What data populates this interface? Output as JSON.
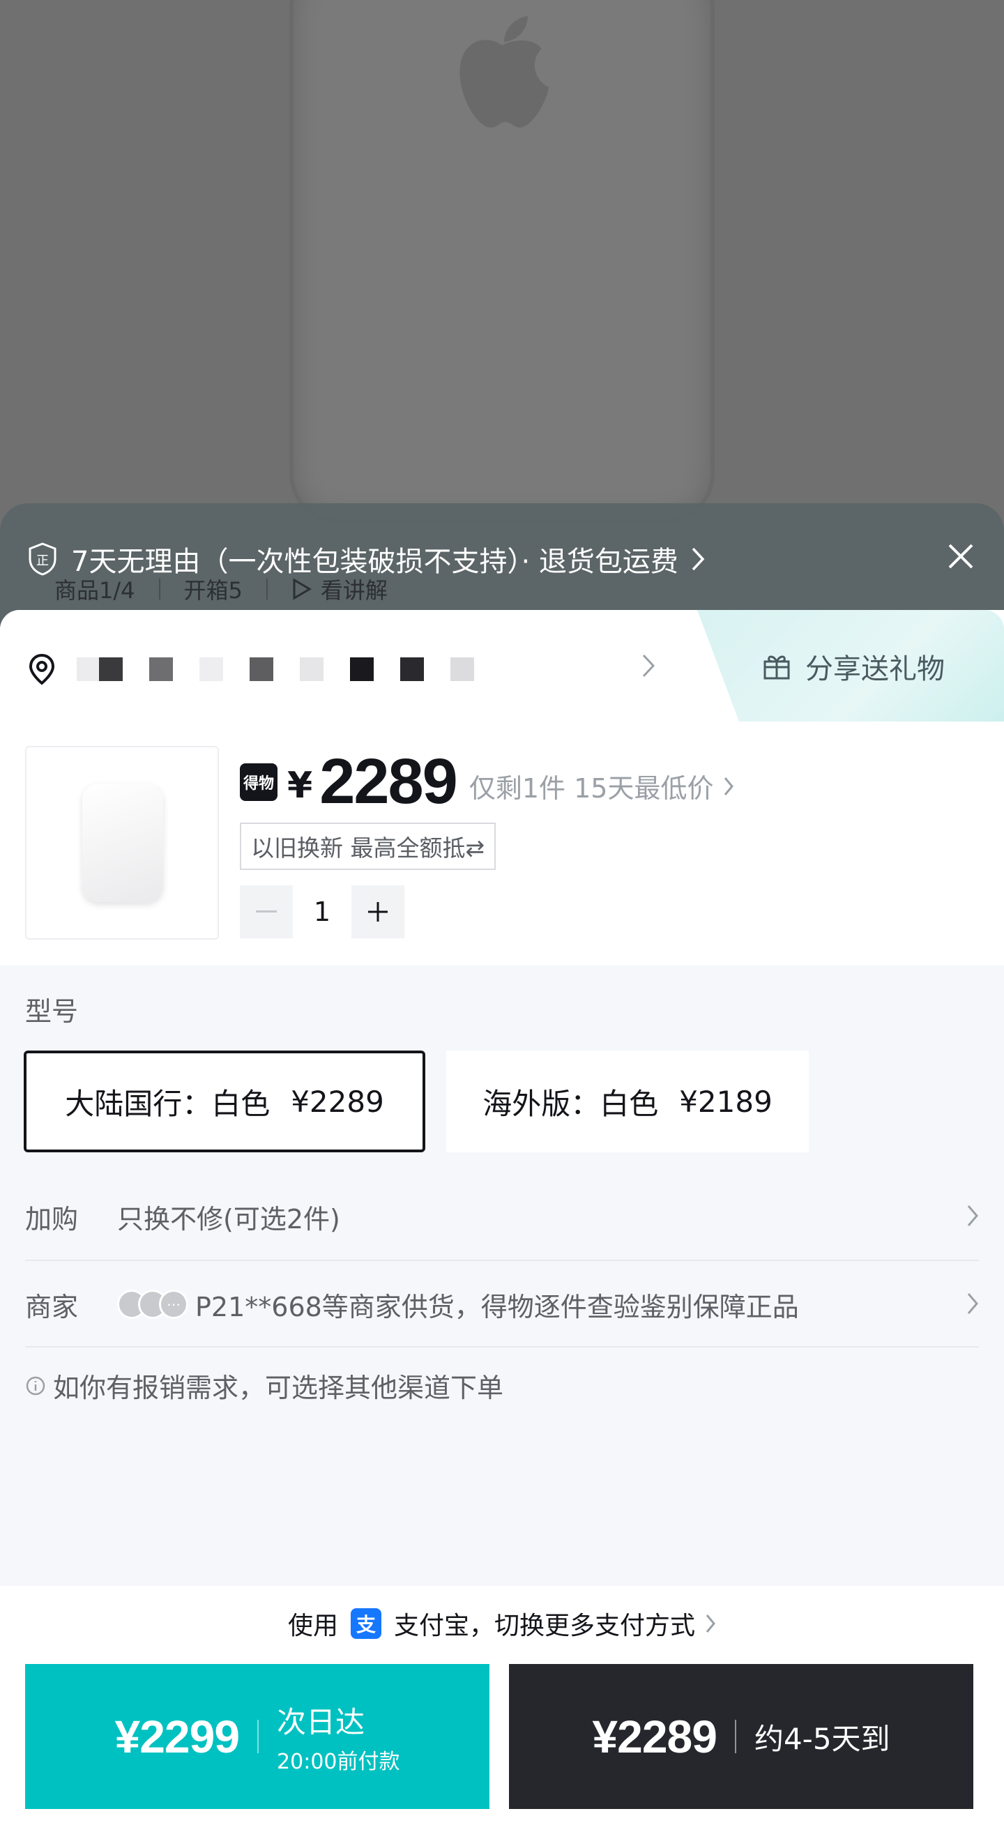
{
  "policy": {
    "text": "7天无理由（一次性包装破损不支持）· 退货包运费"
  },
  "subtabs": [
    "商品1/4",
    "开箱5",
    "看讲解"
  ],
  "gift": {
    "label": "分享送礼物"
  },
  "product": {
    "brand_badge": "得物",
    "currency": "¥",
    "price": "2289",
    "note": "仅剩1件 15天最低价",
    "tradein": "以旧换新 最高全额抵⇄",
    "quantity": "1"
  },
  "variants": {
    "label": "型号",
    "items": [
      {
        "name": "大陆国行：白色",
        "price": "¥2289",
        "selected": true
      },
      {
        "name": "海外版：白色",
        "price": "¥2189",
        "selected": false
      }
    ]
  },
  "addon": {
    "key": "加购",
    "value": "只换不修(可选2件)"
  },
  "merchant": {
    "key": "商家",
    "value": "P21**668等商家供货，得物逐件查验鉴别保障正品"
  },
  "notice": "如你有报销需求，可选择其他渠道下单",
  "payment": {
    "prefix": "使用",
    "alipay_glyph": "支",
    "method": "支付宝，切换更多支付方式"
  },
  "buttons": {
    "fast": {
      "price": "¥2299",
      "label": "次日达",
      "sub": "20:00前付款",
      "color": "#00c1c1"
    },
    "standard": {
      "price": "¥2289",
      "label": "约4-5天到",
      "color": "#26272c"
    }
  }
}
